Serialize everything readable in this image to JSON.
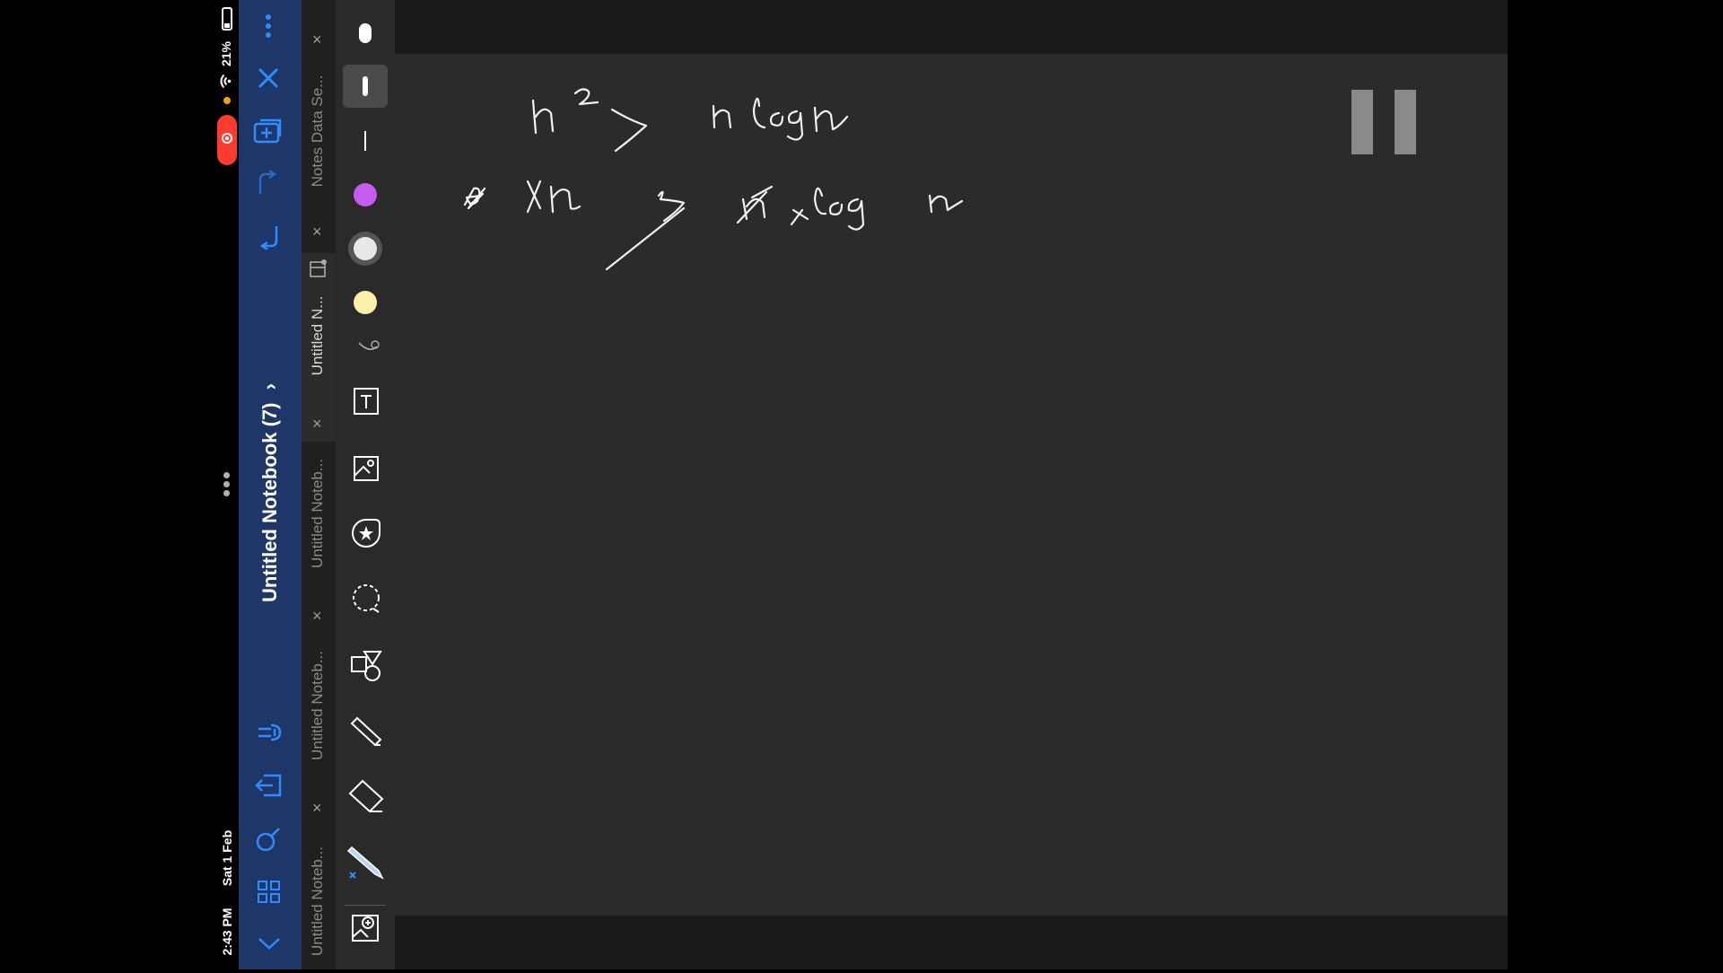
{
  "status": {
    "time": "2:43 PM",
    "date": "Sat 1 Feb",
    "battery": "21%"
  },
  "sidebar": {
    "notebook_title": "Untitled Notebook (7)",
    "chevron": "›",
    "icons": [
      "more-icon",
      "close-icon",
      "add-page-icon",
      "redo-icon",
      "undo-icon",
      "link-icon",
      "export-icon",
      "search-icon",
      "grid-icon",
      "collapse-icon"
    ]
  },
  "tabs": [
    {
      "label": "Notes Data Se...",
      "close": "×"
    },
    {
      "label": "Untitled N...",
      "close": "×"
    },
    {
      "label": "Untitled Noteb...",
      "close": "×"
    },
    {
      "label": "Untitled Noteb...",
      "close": "×"
    },
    {
      "label": "Untitled Noteb...",
      "close": "×"
    }
  ],
  "toolbar": {
    "colors": {
      "purple": "#c55bf0",
      "white": "#e8e8e8",
      "yellow": "#fbf2a8"
    },
    "tools": [
      "pen-size-large",
      "pen-size-medium",
      "pen-size-small",
      "color-purple",
      "color-white",
      "color-yellow",
      "stroke-style",
      "text-tool",
      "image-tool",
      "sticker-tool",
      "lasso-tool",
      "shapes-tool",
      "highlighter-tool",
      "eraser-tool",
      "pen-tool",
      "add-media-tool"
    ]
  },
  "canvas": {
    "background": "#2b2b2b"
  }
}
